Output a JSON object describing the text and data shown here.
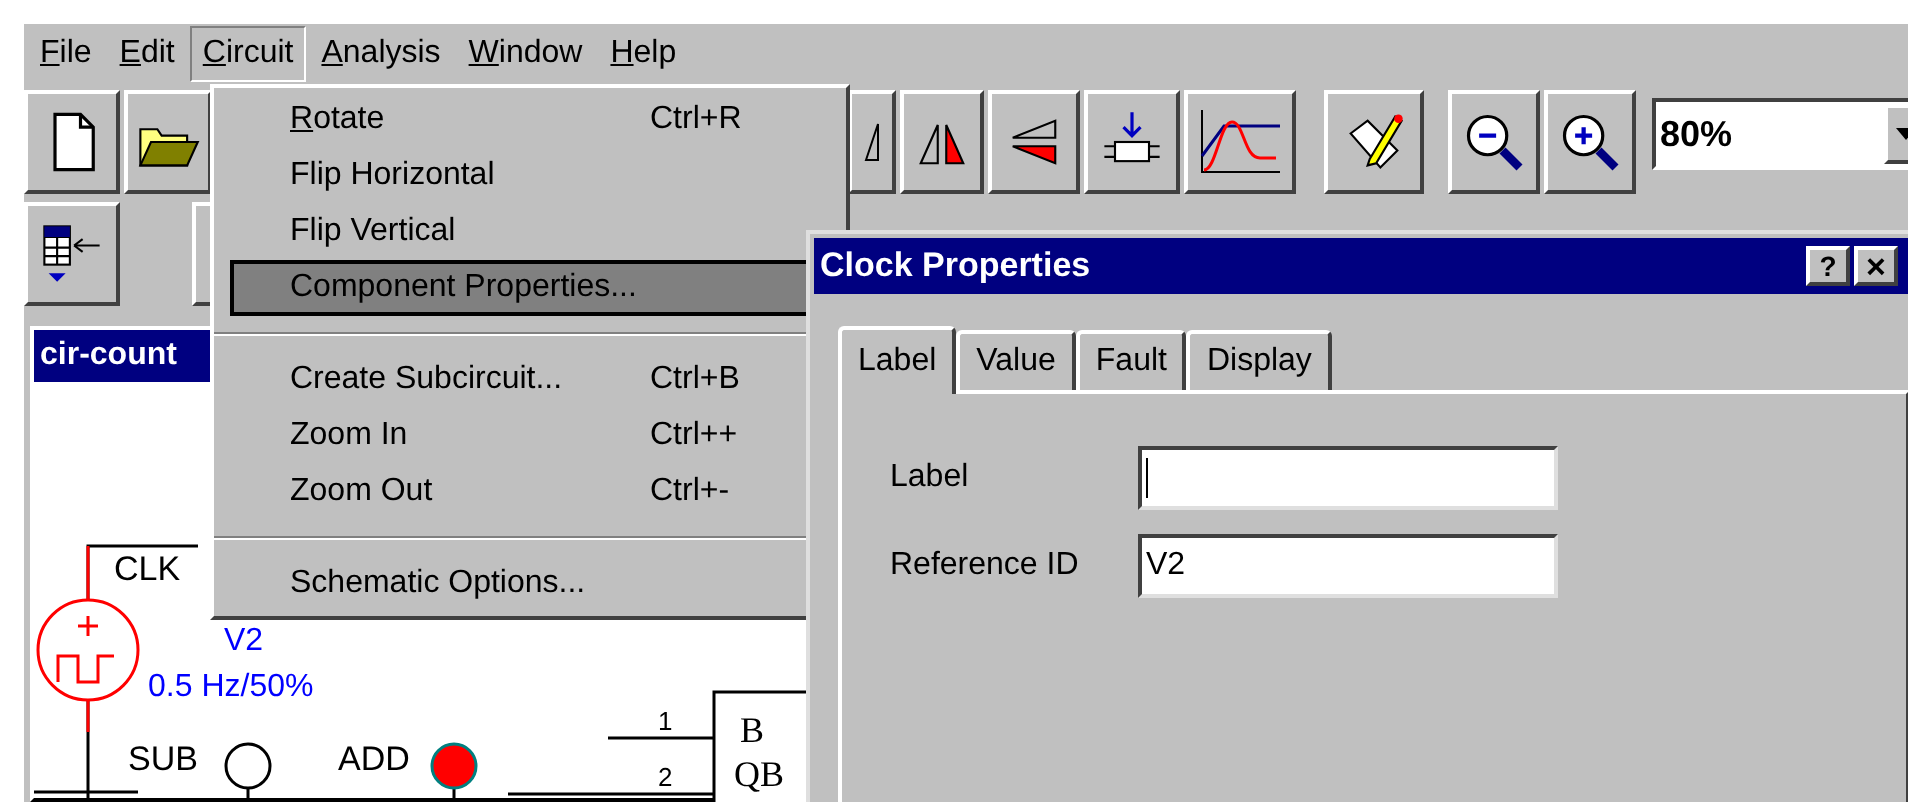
{
  "menu_bar": [
    {
      "mnemonic": "F",
      "label": "ile",
      "open": false
    },
    {
      "mnemonic": "E",
      "label": "dit",
      "open": false
    },
    {
      "mnemonic": "C",
      "label": "ircuit",
      "open": true
    },
    {
      "mnemonic": "A",
      "label": "nalysis",
      "open": false
    },
    {
      "mnemonic": "W",
      "label": "indow",
      "open": false
    },
    {
      "mnemonic": "H",
      "label": "elp",
      "open": false
    }
  ],
  "zoom_combo": {
    "value": "80%"
  },
  "circuit_menu": [
    {
      "kind": "item",
      "mnemonic": "R",
      "label": "otate",
      "shortcut": "Ctrl+R",
      "highlighted": false
    },
    {
      "kind": "item",
      "label": "Flip Horizontal",
      "highlighted": false
    },
    {
      "kind": "item",
      "label": "Flip Vertical",
      "highlighted": false
    },
    {
      "kind": "item",
      "label": "Component Properties...",
      "highlighted": true
    },
    {
      "kind": "separator"
    },
    {
      "kind": "item",
      "label": "Create Subcircuit...",
      "shortcut": "Ctrl+B",
      "highlighted": false
    },
    {
      "kind": "item",
      "label": "Zoom In",
      "shortcut": "Ctrl++",
      "highlighted": false
    },
    {
      "kind": "item",
      "label": "Zoom Out",
      "shortcut": "Ctrl+-",
      "highlighted": false
    },
    {
      "kind": "separator"
    },
    {
      "kind": "item",
      "label": "Schematic Options...",
      "highlighted": false
    }
  ],
  "schematic": {
    "title": "cir-count",
    "clk_label": "CLK",
    "source": {
      "name": "V2",
      "value": "0.5 Hz/50%"
    },
    "switches": [
      {
        "label": "SUB",
        "lit": false
      },
      {
        "label": "ADD",
        "lit": true
      }
    ],
    "chip": {
      "pins": [
        "1",
        "2"
      ],
      "labels": [
        "B",
        "QB"
      ]
    }
  },
  "dialog": {
    "title": "Clock Properties",
    "help": "?",
    "close": "×",
    "tabs": [
      {
        "label": "Label",
        "selected": true
      },
      {
        "label": "Value",
        "selected": false
      },
      {
        "label": "Fault",
        "selected": false
      },
      {
        "label": "Display",
        "selected": false
      }
    ],
    "fields": [
      {
        "label": "Label",
        "focused": true
      },
      {
        "label": "Reference ID",
        "value": "V2",
        "focused": false
      }
    ]
  }
}
